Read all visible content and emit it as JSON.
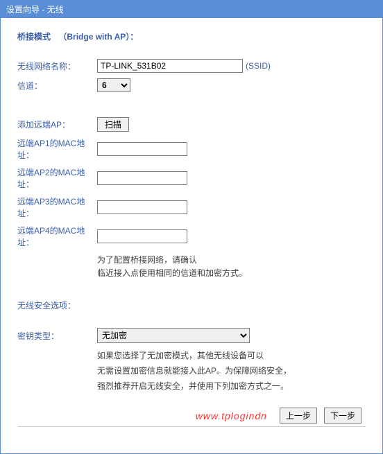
{
  "window": {
    "title": "设置向导 - 无线"
  },
  "header": {
    "mode_label": "桥接模式",
    "mode_en": "（Bridge with AP）："
  },
  "fields": {
    "ssid_label": "无线网络名称：",
    "ssid_value": "TP-LINK_531B02",
    "ssid_suffix": "(SSID)",
    "channel_label": "信道：",
    "channel_value": "6",
    "add_ap_label": "添加远端AP：",
    "scan_btn": "扫描",
    "mac1_label": "远端AP1的MAC地址：",
    "mac2_label": "远端AP2的MAC地址：",
    "mac3_label": "远端AP3的MAC地址：",
    "mac4_label": "远端AP4的MAC地址：",
    "mac1_value": "",
    "mac2_value": "",
    "mac3_value": "",
    "mac4_value": ""
  },
  "hints": {
    "bridge1": "为了配置桥接网络，请确认",
    "bridge2": "临近接入点使用相同的信道和加密方式。"
  },
  "security": {
    "section_label": "无线安全选项：",
    "key_type_label": "密钥类型：",
    "key_type_value": "无加密",
    "hint1": "如果您选择了无加密模式，其他无线设备可以",
    "hint2": "无需设置加密信息就能接入此AP。为保障网络安全，",
    "hint3": "强烈推荐开启无线安全，并使用下列加密方式之一。"
  },
  "footer": {
    "watermark": "www.tplogindn",
    "prev": "上一步",
    "next": "下一步"
  }
}
